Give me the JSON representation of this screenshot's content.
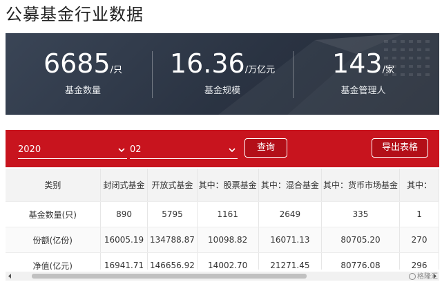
{
  "page": {
    "title": "公募基金行业数据"
  },
  "stats": [
    {
      "value": "6685",
      "unit": "/只",
      "label": "基金数量"
    },
    {
      "value": "16.36",
      "unit": "/万亿元",
      "label": "基金规模"
    },
    {
      "value": "143",
      "unit": "/家",
      "label": "基金管理人"
    }
  ],
  "filters": {
    "year": "2020",
    "month": "02",
    "query_label": "查询",
    "export_label": "导出表格"
  },
  "table": {
    "columns": [
      "类别",
      "封闭式基金",
      "开放式基金",
      "其中：股票基金",
      "其中：混合基金",
      "其中：货币市场基金",
      "其中："
    ],
    "rows": [
      {
        "category": "基金数量(只)",
        "values": [
          "890",
          "5795",
          "1161",
          "2649",
          "335",
          "1"
        ]
      },
      {
        "category": "份额(亿份)",
        "values": [
          "16005.19",
          "134788.87",
          "10098.82",
          "16071.13",
          "80705.20",
          "270"
        ]
      },
      {
        "category": "净值(亿元)",
        "values": [
          "16941.71",
          "146656.92",
          "14002.70",
          "21271.45",
          "80776.08",
          "296"
        ]
      }
    ]
  },
  "watermark": "格隆汇"
}
